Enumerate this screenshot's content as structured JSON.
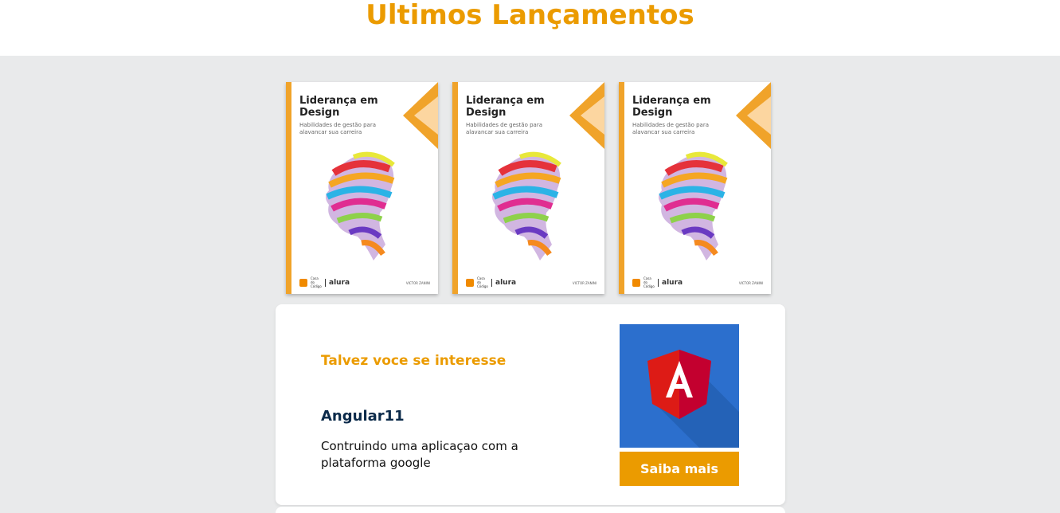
{
  "header": {
    "title": "Ultimos Lançamentos"
  },
  "books": [
    {
      "title": "Liderança em Design",
      "subtitle": "Habilidades de gestão para alavancar sua carreira",
      "publisher_small": "Casa do Código",
      "brand": "alura",
      "author": "VICTOR ZANINI"
    },
    {
      "title": "Liderança em Design",
      "subtitle": "Habilidades de gestão para alavancar sua carreira",
      "publisher_small": "Casa do Código",
      "brand": "alura",
      "author": "VICTOR ZANINI"
    },
    {
      "title": "Liderança em Design",
      "subtitle": "Habilidades de gestão para alavancar sua carreira",
      "publisher_small": "Casa do Código",
      "brand": "alura",
      "author": "VICTOR ZANINI"
    }
  ],
  "promo": {
    "kicker": "Talvez voce se interesse",
    "title": "Angular11",
    "description": "Contruindo uma aplicaçao com a plataforma google",
    "button_label": "Saiba mais",
    "thumbnail_icon": "angular-logo-icon"
  },
  "colors": {
    "accent": "#eb9b00",
    "background": "#e9eaeb",
    "thumb_blue": "#2c6fcd",
    "angular_red": "#dd1b16"
  }
}
